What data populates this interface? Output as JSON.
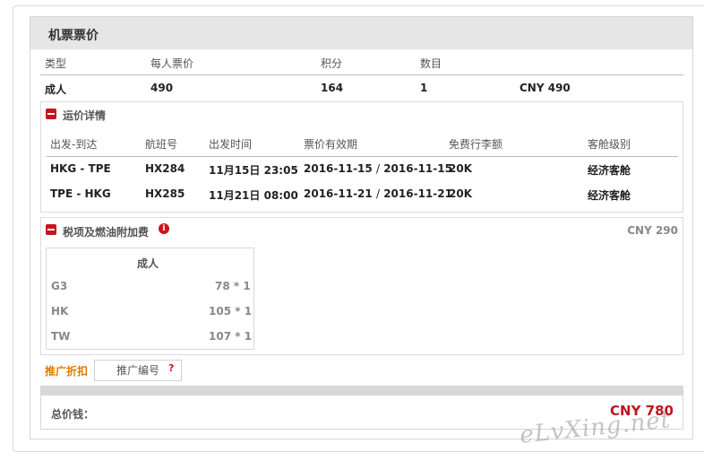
{
  "title": "机票票价",
  "summary": {
    "headers": [
      "类型",
      "每人票价",
      "积分",
      "数目"
    ],
    "row": {
      "type": "成人",
      "price": "490",
      "points": "164",
      "count": "1",
      "subtotal": "CNY 490"
    }
  },
  "fare_details": {
    "title": "运价详情",
    "headers": [
      "出发-到达",
      "航班号",
      "出发时间",
      "票价有效期",
      "免费行李额",
      "客舱级别"
    ],
    "rows": [
      {
        "route": "HKG - TPE",
        "flight": "HX284",
        "date": "11月15日",
        "time": "23:05",
        "valid_from": "2016-11-15",
        "valid_to": "2016-11-15",
        "baggage": "20K",
        "cabin": "经济客舱"
      },
      {
        "route": "TPE - HKG",
        "flight": "HX285",
        "date": "11月21日",
        "time": "08:00",
        "valid_from": "2016-11-21",
        "valid_to": "2016-11-21",
        "baggage": "20K",
        "cabin": "经济客舱"
      }
    ],
    "date_separator": "/"
  },
  "taxes": {
    "title": "税项及燃油附加费",
    "total": "CNY 290",
    "box_header": "成人",
    "items": [
      {
        "code": "G3",
        "amount": "78",
        "mult": "1"
      },
      {
        "code": "HK",
        "amount": "105",
        "mult": "1"
      },
      {
        "code": "TW",
        "amount": "107",
        "mult": "1"
      }
    ],
    "mult_sign": "*"
  },
  "promo": {
    "label": "推广折扣",
    "placeholder": "推广编号",
    "help": "?"
  },
  "total": {
    "label": "总价钱：",
    "amount": "CNY 780"
  },
  "watermark": "eLvXing.net",
  "colors": {
    "accent_red": "#c0151b",
    "promo_orange": "#e07b00",
    "header_grey": "#e6e6e6"
  }
}
